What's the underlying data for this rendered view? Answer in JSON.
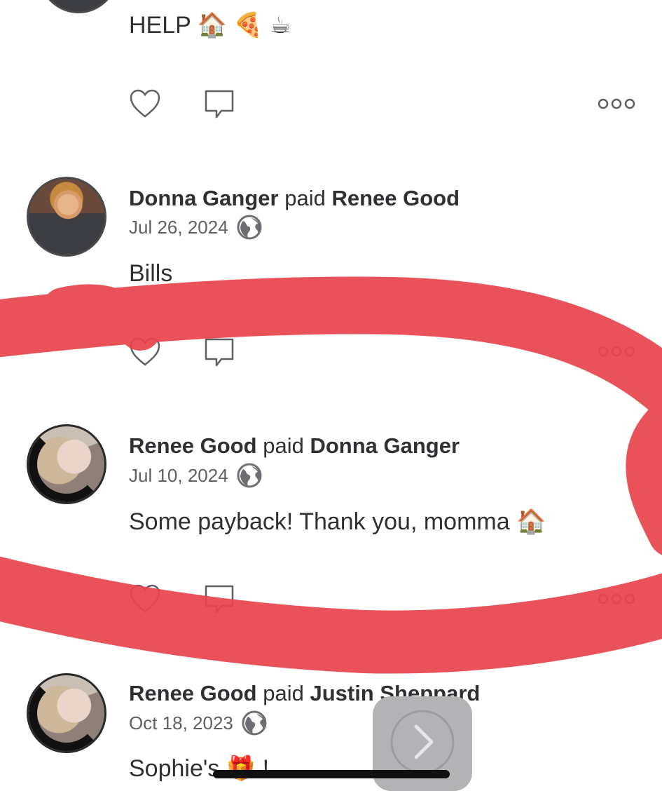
{
  "top_post": {
    "message": "HELP 🏠 🍕 ☕"
  },
  "posts": [
    {
      "payer": "Donna Ganger",
      "verb": "paid",
      "payee": "Renee Good",
      "date": "Jul 26, 2024",
      "message": "Bills"
    },
    {
      "payer": "Renee Good",
      "verb": "paid",
      "payee": "Donna Ganger",
      "date": "Jul 10, 2024",
      "message": "Some payback! Thank you, momma 🏠"
    },
    {
      "payer": "Renee Good",
      "verb": "paid",
      "payee": "Justin Sheppard",
      "date": "Oct 18, 2023",
      "message": "Sophie's 🎁 !"
    }
  ],
  "icons": {
    "like": "heart-icon",
    "comment": "speech-bubble-icon",
    "more": "more-icon",
    "privacy": "globe-icon",
    "next": "chevron-right-icon"
  },
  "colors": {
    "annotation_red": "#e8454d",
    "text": "#2f3033"
  }
}
